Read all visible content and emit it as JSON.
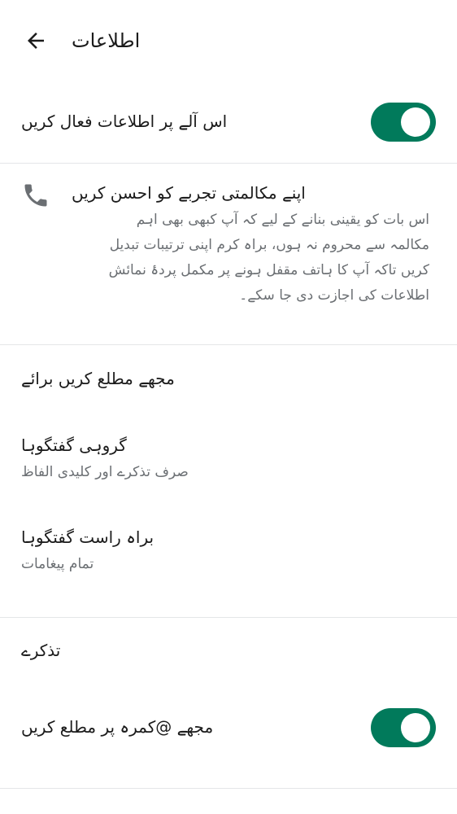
{
  "header": {
    "title": "اطلاعات",
    "back_icon": "arrow-left-icon"
  },
  "app_notifications": {
    "label": "اس آلے پر اطلاعات فعال کریں",
    "enabled": true
  },
  "call_experience": {
    "icon": "phone-icon",
    "title": "اپنے مکالمتی تجربے کو احسن کریں",
    "description_lines": [
      "اس بات کو یقینی بنانے کے لیے کہ آپ کبھی بھی اہم",
      "مکالمہ سے محروم نہ ہوں، براہ کرم اپنی ترتیبات تبدیل",
      "کریں تاکہ آپ کا ہاتف مقفل ہونے پر مکمل پردۂ نمائش",
      "اطلاعات کی اجازت دی جا سکے۔"
    ]
  },
  "notify_me_for": {
    "section_title": "مجھے مطلع کریں برائے",
    "group_chats": {
      "title": "گروہی گفتگوہا",
      "subtitle": "صرف تذکرے اور کلیدی الفاظ"
    },
    "direct_chats": {
      "title": "براہ راست گفتگوہا",
      "subtitle": "تمام پیغامات"
    }
  },
  "mentions": {
    "section_title": "تذکرے",
    "room_mention": {
      "label": "مجھے @کمرہ پر مطلع کریں",
      "enabled": true
    }
  },
  "colors": {
    "toggle_on": "#017a5b",
    "text_primary": "#1b1b1b",
    "text_secondary": "#6b6f73",
    "divider": "#e4e6e8"
  }
}
